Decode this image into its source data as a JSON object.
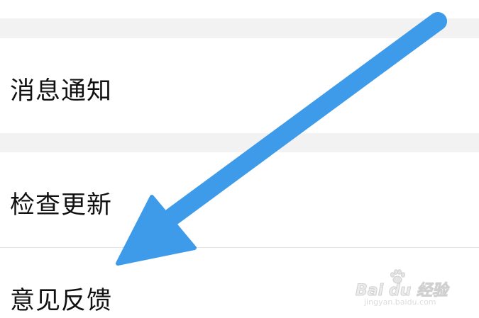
{
  "settings": {
    "items": [
      {
        "label": "消息通知"
      },
      {
        "label": "检查更新"
      },
      {
        "label": "意见反馈"
      }
    ]
  },
  "annotation": {
    "arrow_color": "#3d9be9"
  },
  "watermark": {
    "brand": "Bai du 经验",
    "url": "jingyan.baidu.com"
  },
  "colors": {
    "section_gap": "#f2f2f2",
    "divider": "#e3e3e3",
    "text": "#111111"
  }
}
